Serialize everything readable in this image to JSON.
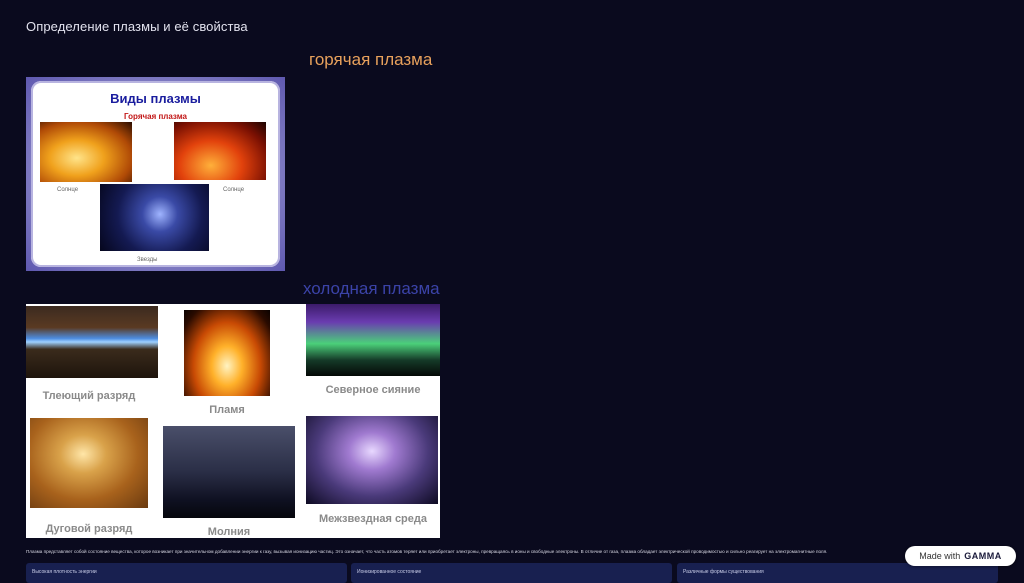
{
  "page": {
    "title": "Определение плазмы и её свойства"
  },
  "hot_section": {
    "heading": "горячая плазма",
    "slide_title": "Виды плазмы",
    "slide_subtitle": "Горячая  плазма",
    "captions": {
      "sun_left": "Солнце",
      "sun_right": "Солнце",
      "stars": "Звезды"
    }
  },
  "cold_section": {
    "heading": "холодная плазма",
    "captions": {
      "glow_discharge": "Тлеющий разряд",
      "flame": "Пламя",
      "aurora": "Северное сияние",
      "arc_discharge": "Дуговой разряд",
      "lightning": "Молния",
      "interstellar": "Межзвездная среда"
    }
  },
  "body": {
    "paragraph": "Плазма представляет собой состояние вещества, которое возникает при значительном добавлении энергии к газу, вызывая ионизацию частиц. Это означает, что часть атомов теряет или приобретает электроны, превращаясь в ионы и свободные электроны. В отличие от газа, плазма обладает электрической проводимостью и сильно реагирует на электромагнитные поля."
  },
  "cards": [
    {
      "label": "Высокая плотность энергии"
    },
    {
      "label": "Ионизированное состояние"
    },
    {
      "label": "Различные формы существования"
    }
  ],
  "badge": {
    "prefix": "Made with",
    "brand": "GAMMA"
  },
  "colors": {
    "background": "#0a0a1e",
    "hot_heading": "#e8a15c",
    "cold_heading": "#3b43a8"
  }
}
